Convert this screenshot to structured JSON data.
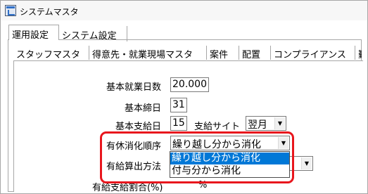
{
  "window": {
    "title": "システムマスタ"
  },
  "tabs_outer": [
    "運用設定",
    "システム設定"
  ],
  "tabs_inner": [
    "スタッフマスタ",
    "得意先・就業現場マスタ",
    "案件",
    "配置",
    "コンプライアンス",
    "勤"
  ],
  "form": {
    "working_days": {
      "label": "基本就業日数",
      "value": "20.000"
    },
    "closing_day": {
      "label": "基本締日",
      "value": "31"
    },
    "payment_day": {
      "label": "基本支給日",
      "value": "15"
    },
    "payment_site": {
      "label": "支給サイト",
      "value": "翌月"
    },
    "leave_order": {
      "label": "有休消化順序",
      "value": "繰り越し分から消化"
    },
    "leave_calc": {
      "label": "有給算出方法",
      "value": ""
    },
    "leave_ratio": {
      "label": "有給支給割合(%)",
      "value": "",
      "unit": "%"
    }
  },
  "dropdown": {
    "options": [
      "繰り越し分から消化",
      "付与分から消化"
    ],
    "selected_index": 0
  },
  "colors": {
    "highlight": "#e8161d",
    "selection": "#0078d7"
  }
}
